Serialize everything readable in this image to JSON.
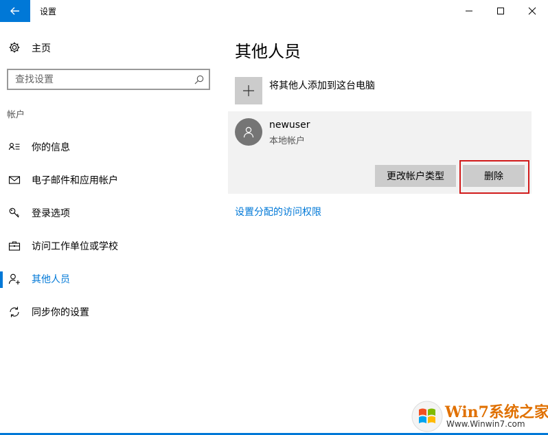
{
  "window": {
    "title": "设置"
  },
  "sidebar": {
    "home_label": "主页",
    "search_placeholder": "查找设置",
    "section_label": "帐户",
    "items": [
      {
        "label": "你的信息",
        "icon": "person-list-icon"
      },
      {
        "label": "电子邮件和应用帐户",
        "icon": "mail-icon"
      },
      {
        "label": "登录选项",
        "icon": "key-icon"
      },
      {
        "label": "访问工作单位或学校",
        "icon": "briefcase-icon"
      },
      {
        "label": "其他人员",
        "icon": "add-person-icon",
        "active": true
      },
      {
        "label": "同步你的设置",
        "icon": "sync-icon"
      }
    ]
  },
  "main": {
    "title": "其他人员",
    "add_label": "将其他人添加到这台电脑",
    "user": {
      "name": "newuser",
      "type": "本地帐户",
      "change_type_label": "更改帐户类型",
      "delete_label": "删除"
    },
    "access_link": "设置分配的访问权限"
  },
  "watermark": {
    "brand": "Win7系统之家",
    "url": "Www.Winwin7.com"
  },
  "colors": {
    "accent": "#0078d7",
    "highlight": "#d11a1a",
    "card": "#f2f2f2",
    "button": "#cccccc"
  }
}
